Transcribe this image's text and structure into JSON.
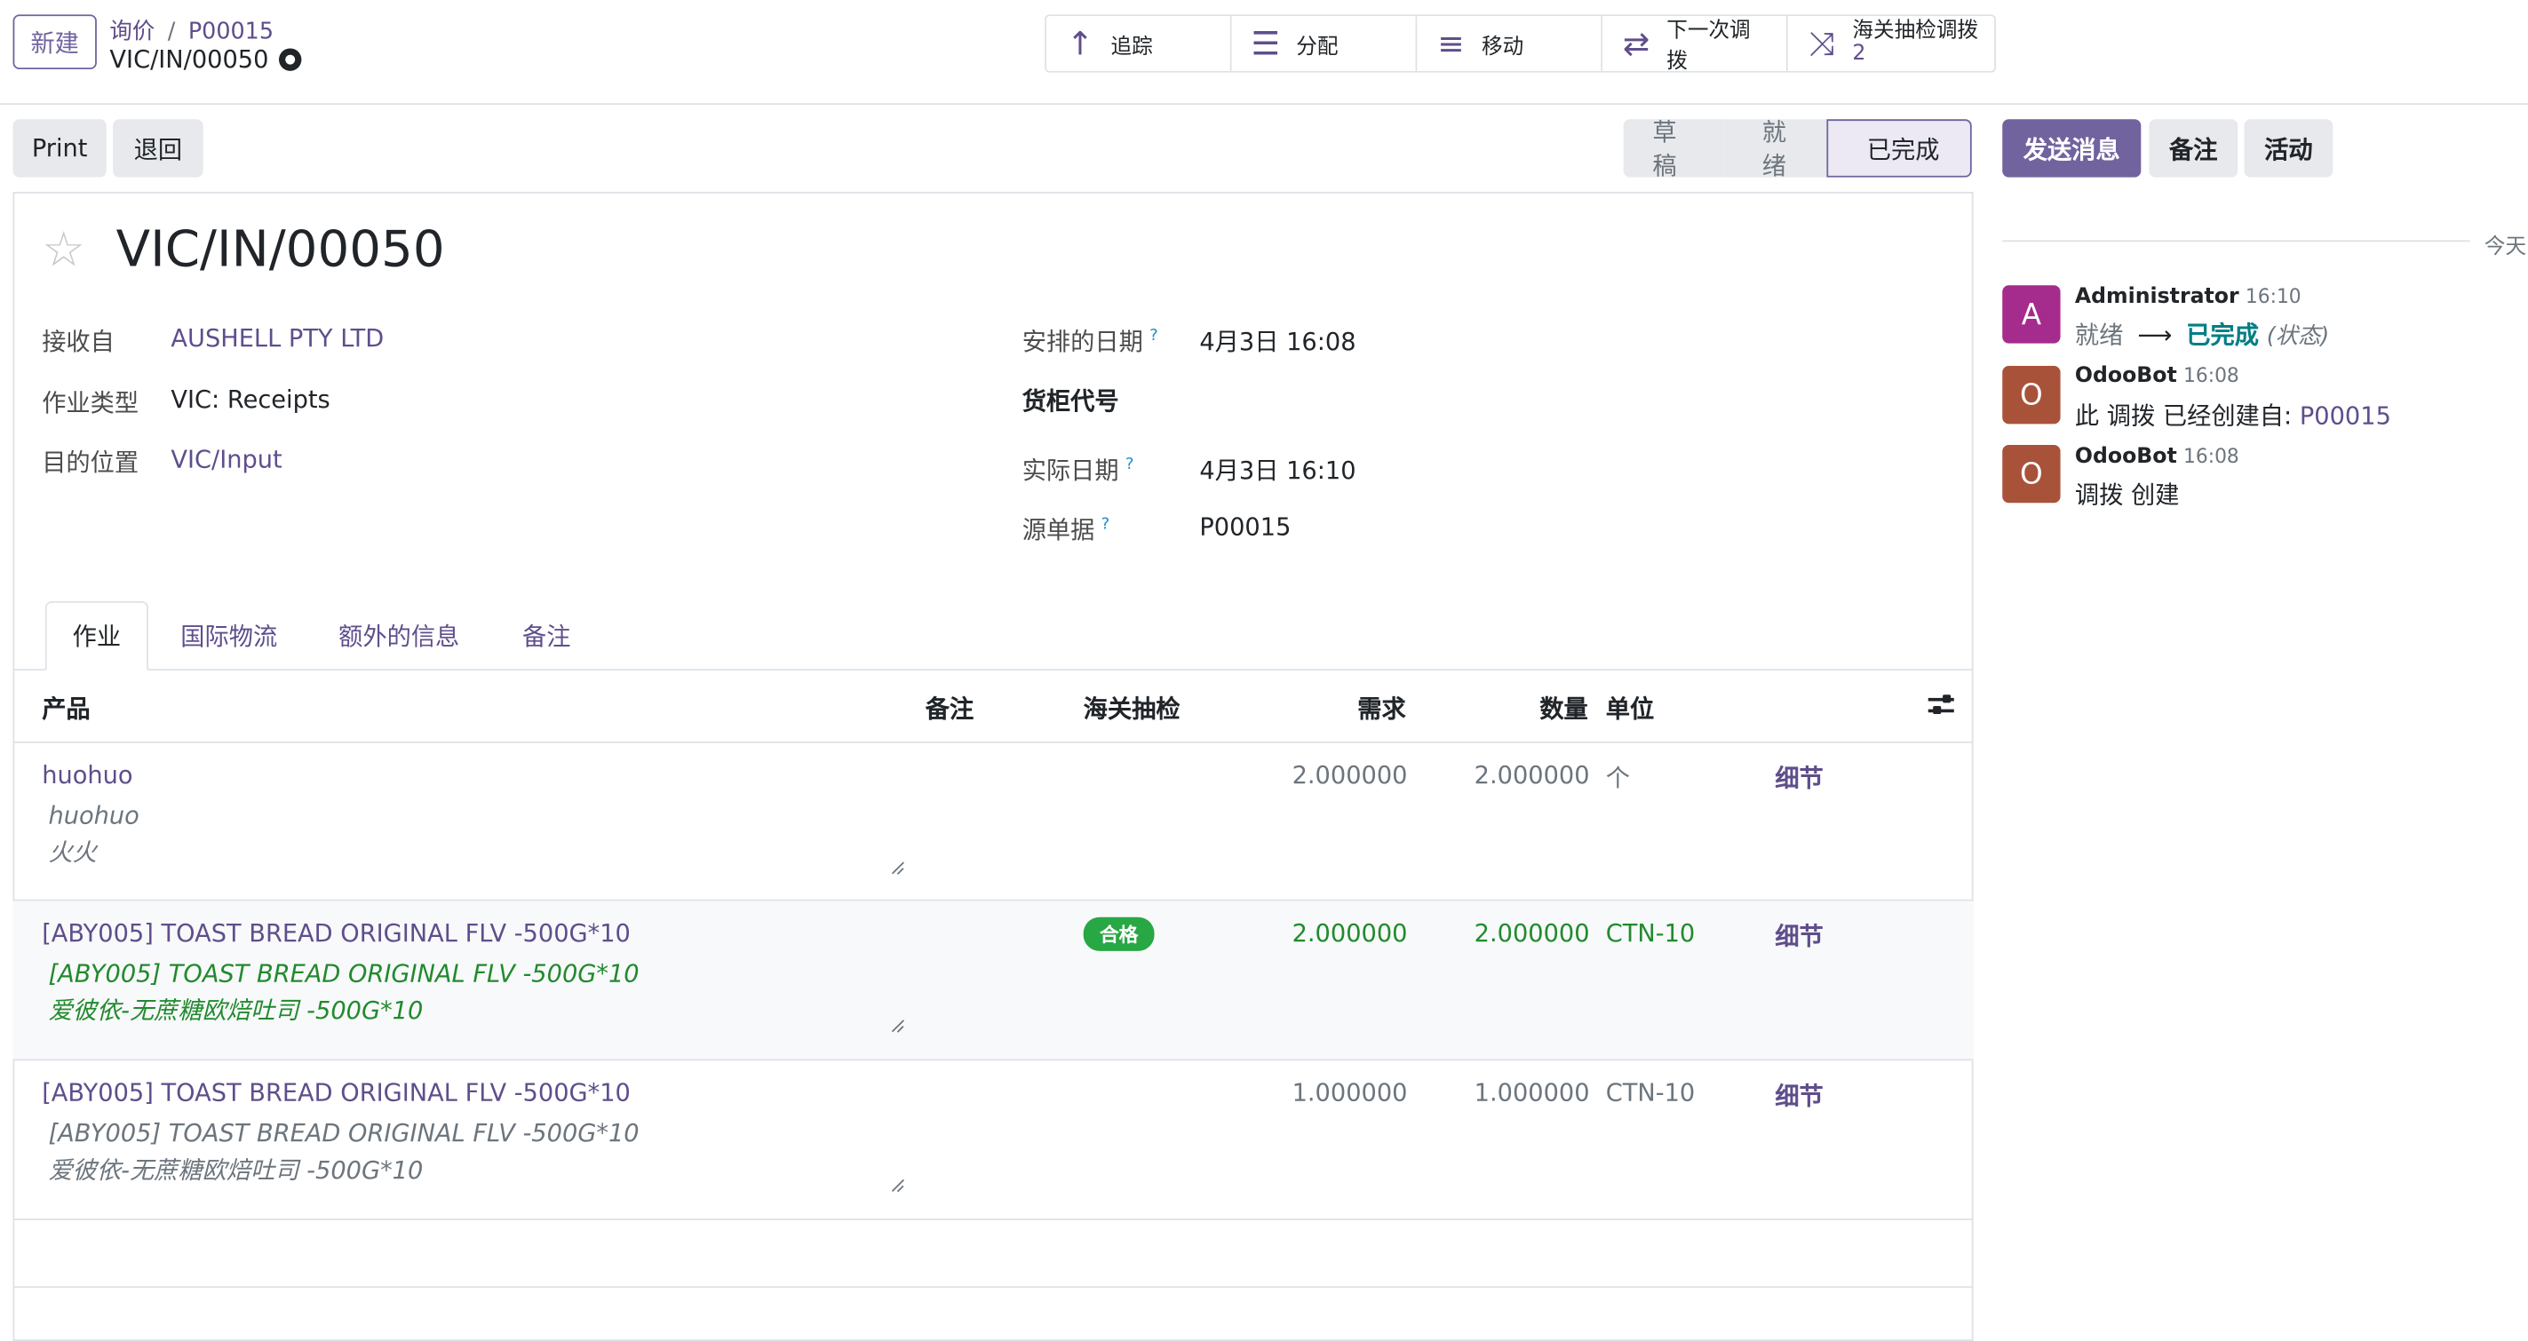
{
  "control_panel": {
    "new_button": "新建",
    "breadcrumb": [
      "询价",
      "P00015"
    ],
    "breadcrumb_sep": "/",
    "record_name": "VIC/IN/00050"
  },
  "smart_buttons": [
    {
      "icon": "arrow-up-icon",
      "label": "追踪"
    },
    {
      "icon": "list-icon",
      "label": "分配"
    },
    {
      "icon": "bars-icon",
      "label": "移动"
    },
    {
      "icon": "exchange-icon",
      "label": "下一次调拨"
    },
    {
      "icon": "random-icon",
      "label": "海关抽检调拨",
      "count": "2"
    }
  ],
  "actions": {
    "print": "Print",
    "return": "退回"
  },
  "statusbar": {
    "stages": [
      "草稿",
      "就绪",
      "已完成"
    ],
    "current": "已完成"
  },
  "form": {
    "title": "VIC/IN/00050",
    "left_fields": [
      {
        "label": "接收自",
        "value": "AUSHELL PTY LTD",
        "link": true
      },
      {
        "label": "作业类型",
        "value": "VIC: Receipts",
        "link": false
      },
      {
        "label": "目的位置",
        "value": "VIC/Input",
        "link": true
      }
    ],
    "right_fields": [
      {
        "label": "安排的日期",
        "help": "?",
        "value": "4月3日 16:08"
      },
      {
        "label": "货柜代号",
        "help": "",
        "value": ""
      },
      {
        "label": "实际日期",
        "help": "?",
        "value": "4月3日 16:10"
      },
      {
        "label": "源单据",
        "help": "?",
        "value": "P00015"
      }
    ],
    "tabs": [
      "作业",
      "国际物流",
      "额外的信息",
      "备注"
    ],
    "active_tab": "作业"
  },
  "table": {
    "headers": {
      "product": "产品",
      "note": "备注",
      "customs": "海关抽检",
      "demand": "需求",
      "quantity": "数量",
      "uom": "单位"
    },
    "rows": [
      {
        "product": "huohuo",
        "desc1": "huohuo",
        "desc2": "火火",
        "customs": "",
        "demand": "2.000000",
        "quantity": "2.000000",
        "uom": "个",
        "detail": "细节",
        "highlight": false
      },
      {
        "product": "[ABY005] TOAST BREAD ORIGINAL FLV -500G*10",
        "desc1": "[ABY005] TOAST BREAD ORIGINAL FLV -500G*10",
        "desc2": "爱彼依-无蔗糖欧焙吐司 -500G*10",
        "customs": "合格",
        "demand": "2.000000",
        "quantity": "2.000000",
        "uom": "CTN-10",
        "detail": "细节",
        "highlight": true
      },
      {
        "product": "[ABY005] TOAST BREAD ORIGINAL FLV -500G*10",
        "desc1": "[ABY005] TOAST BREAD ORIGINAL FLV -500G*10",
        "desc2": "爱彼依-无蔗糖欧焙吐司 -500G*10",
        "customs": "",
        "demand": "1.000000",
        "quantity": "1.000000",
        "uom": "CTN-10",
        "detail": "细节",
        "highlight": false
      }
    ]
  },
  "chatter": {
    "send_message": "发送消息",
    "log_note": "备注",
    "activities": "活动",
    "date_separator": "今天",
    "messages": [
      {
        "avatar": "A",
        "avatar_color": "#a52b8c",
        "author": "Administrator",
        "time": "16:10",
        "from": "就绪",
        "arrow": "⟶",
        "to": "已完成",
        "field": "(状态)"
      },
      {
        "avatar": "O",
        "avatar_color": "#a9523a",
        "author": "OdooBot",
        "time": "16:08",
        "body": "此 调拨 已经创建自:",
        "link": "P00015"
      },
      {
        "avatar": "O",
        "avatar_color": "#a9523a",
        "author": "OdooBot",
        "time": "16:08",
        "body": "调拨 创建"
      }
    ]
  },
  "colors": {
    "brand": "#71639e",
    "link": "#5f4e8c",
    "success": "#218a2e",
    "tracking_to": "#017e84"
  }
}
